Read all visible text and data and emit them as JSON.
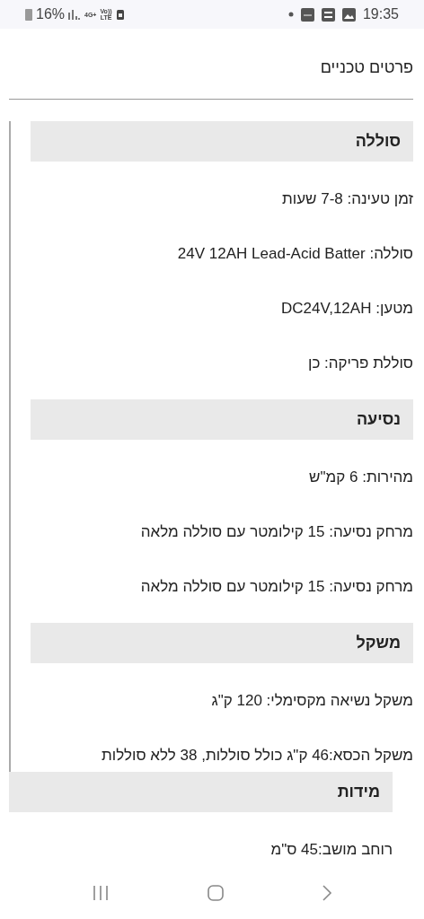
{
  "status_bar": {
    "battery": "16%",
    "network": "4G+",
    "volte": "Vo))\nLTE",
    "time": "19:35"
  },
  "page_title": "פרטים טכניים",
  "sections": [
    {
      "title": "סוללה",
      "bordered": true,
      "rows": [
        "זמן טעינה: 7-8 שעות",
        "סוללה: 24V 12AH Lead-Acid Batter",
        "מטען: DC24V,12AH",
        "סוללת פריקה: כן"
      ]
    },
    {
      "title": "נסיעה",
      "bordered": true,
      "rows": [
        "מהירות: 6 קמ\"ש",
        "מרחק נסיעה: 15 קילומטר עם סוללה מלאה",
        "מרחק נסיעה: 15 קילומטר עם סוללה מלאה"
      ]
    },
    {
      "title": "משקל",
      "bordered": true,
      "rows": [
        "משקל נשיאה מקסימלי: 120 ק\"ג",
        "משקל הכסא:46 ק\"ג כולל סוללות, 38 ללא סוללות"
      ]
    },
    {
      "title": "מידות",
      "bordered": false,
      "rows": [
        "רוחב מושב:45 ס\"מ"
      ]
    }
  ]
}
